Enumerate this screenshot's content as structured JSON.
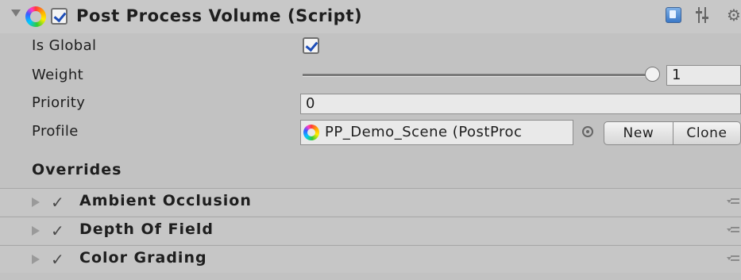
{
  "header": {
    "title": "Post Process Volume (Script)",
    "enabled": true,
    "icons": [
      "foldout-arrow-icon",
      "post-process-ring-icon",
      "enable-checkbox",
      "help-book-icon",
      "preset-sliders-icon",
      "gear-icon"
    ]
  },
  "properties": {
    "is_global": {
      "label": "Is Global",
      "checked": true
    },
    "weight": {
      "label": "Weight",
      "value": "1",
      "slider_fraction": 1.0
    },
    "priority": {
      "label": "Priority",
      "value": "0"
    },
    "profile": {
      "label": "Profile",
      "value": "PP_Demo_Scene (PostProc",
      "new_label": "New",
      "clone_label": "Clone"
    }
  },
  "overrides": {
    "title": "Overrides",
    "items": [
      {
        "label": "Ambient Occlusion",
        "enabled": true
      },
      {
        "label": "Depth Of Field",
        "enabled": true
      },
      {
        "label": "Color Grading",
        "enabled": true
      }
    ]
  },
  "colors": {
    "panel_bg": "#c2c2c2",
    "checkmark_blue": "#1c4db8",
    "field_bg": "#e9e9e9"
  }
}
